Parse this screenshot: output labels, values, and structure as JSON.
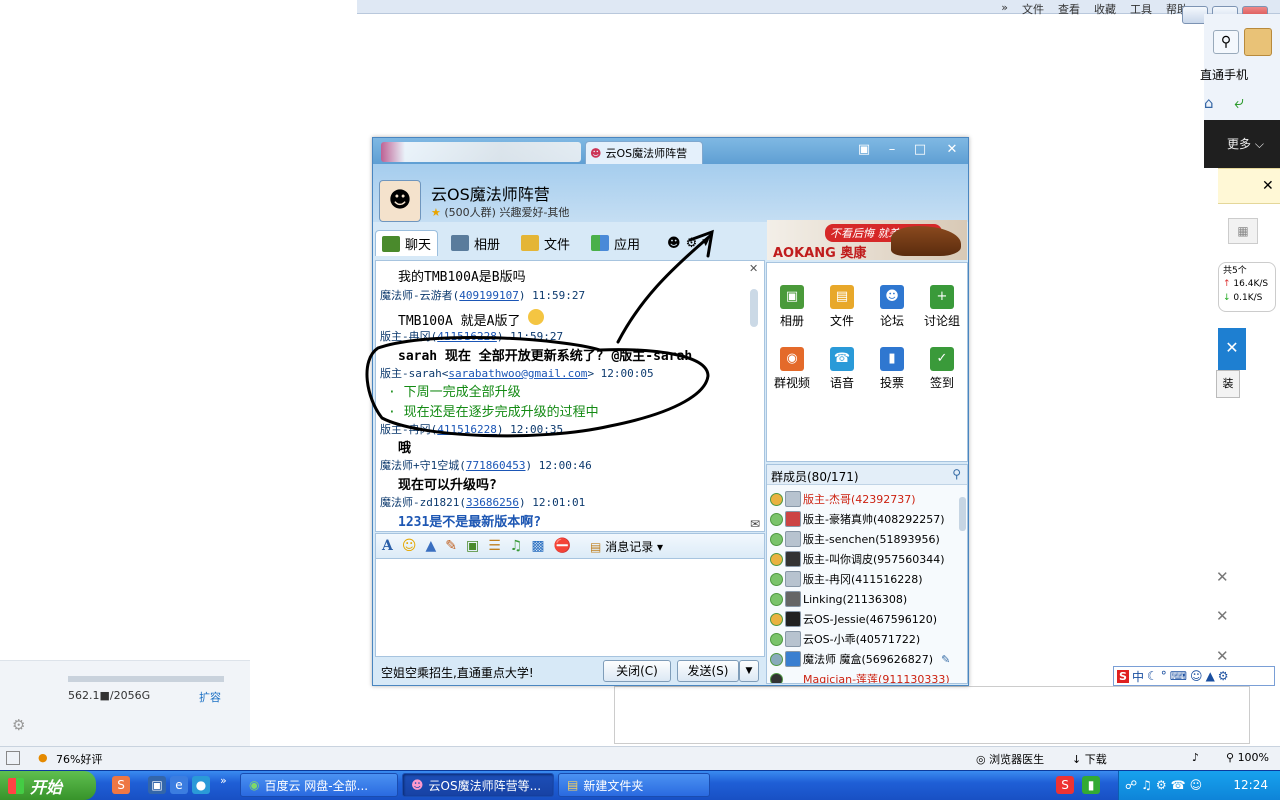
{
  "browser": {
    "menu": [
      "»",
      "文件",
      "查看",
      "收藏",
      "工具",
      "帮助"
    ],
    "phone_label": "直通手机",
    "more_label": "更多",
    "speed_up": "16.4K/S",
    "speed_down": "0.1K/S",
    "speed_head": "共5个",
    "install_label": "装",
    "quota": "562.1■/2056G",
    "expand_label": "扩容",
    "status_rating": "76%好评",
    "status_doctor": "浏览器医生",
    "status_download": "下载",
    "zoom": "100%"
  },
  "qq": {
    "tab_title": "云OS魔法师阵营",
    "group_name": "云OS魔法师阵营",
    "group_sub": "(500人群) 兴趣爱好-其他",
    "tabs": [
      "聊天",
      "相册",
      "文件",
      "应用"
    ],
    "ad_brand": "AOKANG 奥康",
    "ad_slogan": "不看后悔 就差白送了!",
    "messages": [
      {
        "body": "我的TMB100A是B版吗"
      },
      {
        "header_name": "魔法师-云游者(",
        "header_id": "409199107",
        "header_time": ")   11:59:27"
      },
      {
        "body": "TMB100A 就是A版了"
      },
      {
        "header_name": "版主-冉冈(",
        "header_id": "411516228",
        "header_time": ")   11:59:27"
      },
      {
        "body": "sarah 现在 全部开放更新系统了? @版主-sarah"
      },
      {
        "header_name": "版主-sarah<",
        "header_id": "sarabathwoo@gmail.com",
        "header_time": ">   12:00:05"
      },
      {
        "body": "· 下周一完成全部升级"
      },
      {
        "body": "· 现在还是在逐步完成升级的过程中"
      },
      {
        "header_name": "版主-冉冈(",
        "header_id": "411516228",
        "header_time": ")   12:00:35"
      },
      {
        "body": "哦"
      },
      {
        "header_name": "魔法师+守1空城(",
        "header_id": "771860453",
        "header_time": ")   12:00:46"
      },
      {
        "body": "现在可以升级吗?"
      },
      {
        "header_name": "魔法师-zd1821(",
        "header_id": "33686256",
        "header_time": ")   12:01:01"
      },
      {
        "body": "1231是不是最新版本啊?"
      }
    ],
    "history_label": "消息记录",
    "bottom_ad": "空姐空乘招生,直通重点大学!",
    "close_label": "关闭(C)",
    "send_label": "发送(S)",
    "apps": [
      "相册",
      "文件",
      "论坛",
      "讨论组",
      "群视频",
      "语音",
      "投票",
      "签到"
    ],
    "members_head": "群成员(80/171)",
    "members": [
      "版主-杰哥(42392737)",
      "版主-豪猪真帅(408292257)",
      "版主-senchen(51893956)",
      "版主-叫你调皮(957560344)",
      "版主-冉冈(411516228)",
      "Linking(21136308)",
      "云OS-Jessie(467596120)",
      "云OS-小乖(40571722)",
      "魔法师 魔盒(569626827)",
      "Magician-莲莲(911130333)"
    ]
  },
  "taskbar": {
    "start": "开始",
    "tasks": [
      "百度云 网盘-全部...",
      "云OS魔法师阵营等...",
      "新建文件夹"
    ],
    "clock": "12:24"
  },
  "ime": {
    "label": "中"
  }
}
